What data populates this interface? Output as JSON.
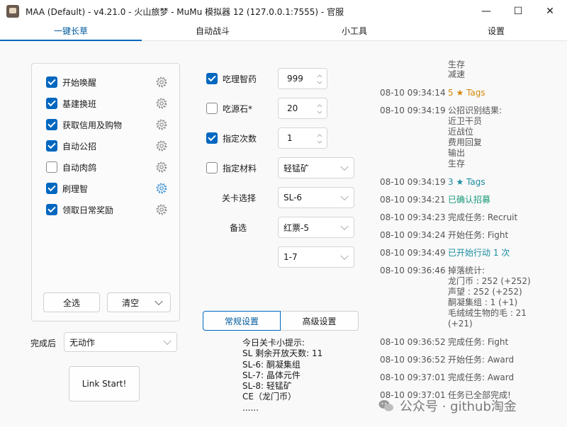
{
  "window": {
    "title": "MAA (Default) - v4.21.0 - 火山旅梦 - MuMu 模拟器 12 (127.0.0.1:7555) - 官服",
    "controls": [
      "—",
      "☐",
      "✕"
    ]
  },
  "tabs": [
    "一键长草",
    "自动战斗",
    "小工具",
    "设置"
  ],
  "tasks": [
    {
      "label": "开始唤醒",
      "checked": true
    },
    {
      "label": "基建换班",
      "checked": true
    },
    {
      "label": "获取信用及购物",
      "checked": true
    },
    {
      "label": "自动公招",
      "checked": true
    },
    {
      "label": "自动肉鸽",
      "checked": false
    },
    {
      "label": "刷理智",
      "checked": true
    },
    {
      "label": "领取日常奖励",
      "checked": true
    }
  ],
  "task_buttons": {
    "select_all": "全选",
    "clear": "清空"
  },
  "finish": {
    "label": "完成后",
    "value": "无动作"
  },
  "link_start": "Link Start!",
  "options": {
    "medicine": {
      "label": "吃理智药",
      "checked": true,
      "value": "999"
    },
    "stone": {
      "label": "吃源石*",
      "checked": false,
      "value": "20"
    },
    "times": {
      "label": "指定次数",
      "checked": true,
      "value": "1"
    },
    "material": {
      "label": "指定材料",
      "checked": false,
      "value": "轻锰矿"
    },
    "stage": {
      "label": "关卡选择",
      "value": "SL-6"
    },
    "backup": {
      "label": "备选",
      "value": "红票-5"
    },
    "backup2": {
      "value": "1-7"
    }
  },
  "settings_tabs": {
    "normal": "常规设置",
    "advanced": "高级设置"
  },
  "tips": [
    "今日关卡小提示:",
    "SL 剩余开放天数: 11",
    "SL-6: 酮凝集组",
    "SL-7: 晶体元件",
    "SL-8: 轻锰矿",
    "CE（龙门币）",
    "......"
  ],
  "log_top": "生存\n减速",
  "log": [
    {
      "time": "08-10  09:34:14",
      "msg": "5 ★ Tags",
      "color": "#d4860b"
    },
    {
      "time": "08-10  09:34:19",
      "msg": "公招识别结果:\n近卫干员\n近战位\n费用回复\n输出\n生存",
      "color": "#555555"
    },
    {
      "time": "08-10  09:34:19",
      "msg": "3 ★ Tags",
      "color": "#1a8ca0"
    },
    {
      "time": "08-10  09:34:21",
      "msg": "已确认招募",
      "color": "#1a9a7a"
    },
    {
      "time": "08-10  09:34:23",
      "msg": "完成任务: Recruit",
      "color": "#555555"
    },
    {
      "time": "08-10  09:34:24",
      "msg": "开始任务: Fight",
      "color": "#555555"
    },
    {
      "time": "08-10  09:34:49",
      "msg": "已开始行动 1 次",
      "color": "#1a8ca0"
    },
    {
      "time": "08-10  09:36:46",
      "msg": "掉落统计:\n龙门币 : 252 (+252)\n声望 : 252 (+252)\n酮凝集组 : 1 (+1)\n毛绒绒生物的毛 : 21\n(+21)",
      "color": "#555555"
    },
    {
      "time": "08-10  09:36:52",
      "msg": "完成任务: Fight",
      "color": "#555555"
    },
    {
      "time": "08-10  09:36:52",
      "msg": "开始任务: Award",
      "color": "#555555"
    },
    {
      "time": "08-10  09:37:01",
      "msg": "完成任务: Award",
      "color": "#555555"
    },
    {
      "time": "08-10  09:37:01",
      "msg": "任务已全部完成!",
      "color": "#555555"
    }
  ],
  "watermark": "公众号 · github淘金",
  "colors": {
    "accent": "#0067c0",
    "orange": "#d4860b",
    "teal": "#1a8ca0"
  }
}
